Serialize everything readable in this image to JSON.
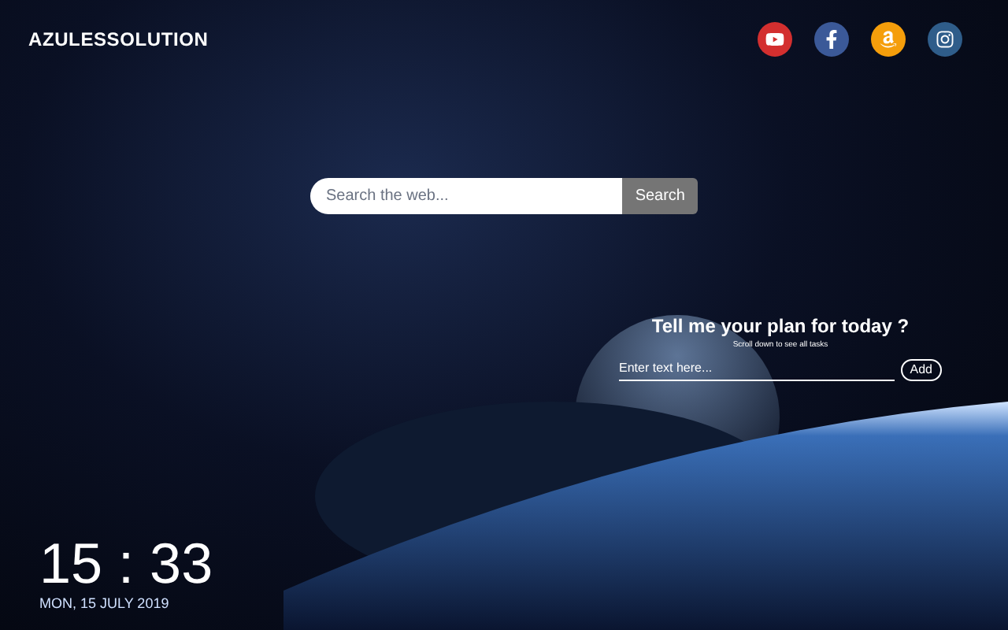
{
  "brand": "AZULESSOLUTION",
  "social_links": [
    {
      "kind": "video",
      "color": "#d32f2f"
    },
    {
      "kind": "facebook",
      "color": "#3b5998"
    },
    {
      "kind": "shop",
      "color": "#f59e0b"
    },
    {
      "kind": "camera",
      "color": "#2f5d8a"
    }
  ],
  "search": {
    "placeholder": "Search the web...",
    "button": "Search"
  },
  "todo": {
    "title": "Tell me your plan for today ?",
    "hint": "Scroll down to see all tasks",
    "placeholder": "Enter text here...",
    "button": "Add"
  },
  "clock": {
    "time": "15 : 33",
    "date": "MON, 15 JULY 2019"
  }
}
